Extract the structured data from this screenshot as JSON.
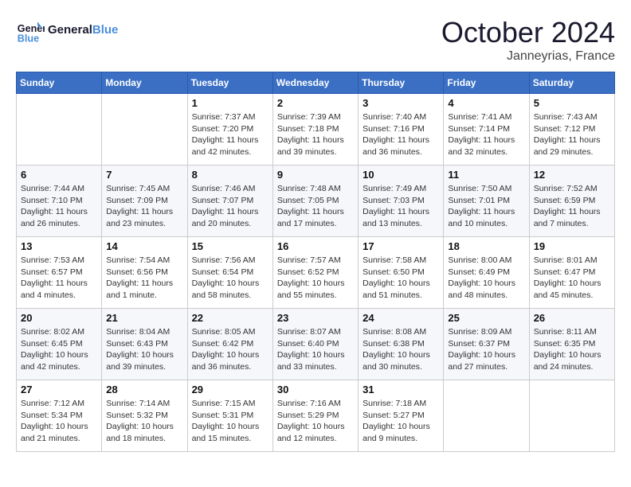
{
  "header": {
    "logo_general": "General",
    "logo_blue": "Blue",
    "month": "October 2024",
    "location": "Janneyrias, France"
  },
  "weekdays": [
    "Sunday",
    "Monday",
    "Tuesday",
    "Wednesday",
    "Thursday",
    "Friday",
    "Saturday"
  ],
  "weeks": [
    [
      {
        "day": "",
        "empty": true
      },
      {
        "day": "",
        "empty": true
      },
      {
        "day": "1",
        "sunrise": "Sunrise: 7:37 AM",
        "sunset": "Sunset: 7:20 PM",
        "daylight": "Daylight: 11 hours and 42 minutes."
      },
      {
        "day": "2",
        "sunrise": "Sunrise: 7:39 AM",
        "sunset": "Sunset: 7:18 PM",
        "daylight": "Daylight: 11 hours and 39 minutes."
      },
      {
        "day": "3",
        "sunrise": "Sunrise: 7:40 AM",
        "sunset": "Sunset: 7:16 PM",
        "daylight": "Daylight: 11 hours and 36 minutes."
      },
      {
        "day": "4",
        "sunrise": "Sunrise: 7:41 AM",
        "sunset": "Sunset: 7:14 PM",
        "daylight": "Daylight: 11 hours and 32 minutes."
      },
      {
        "day": "5",
        "sunrise": "Sunrise: 7:43 AM",
        "sunset": "Sunset: 7:12 PM",
        "daylight": "Daylight: 11 hours and 29 minutes."
      }
    ],
    [
      {
        "day": "6",
        "sunrise": "Sunrise: 7:44 AM",
        "sunset": "Sunset: 7:10 PM",
        "daylight": "Daylight: 11 hours and 26 minutes."
      },
      {
        "day": "7",
        "sunrise": "Sunrise: 7:45 AM",
        "sunset": "Sunset: 7:09 PM",
        "daylight": "Daylight: 11 hours and 23 minutes."
      },
      {
        "day": "8",
        "sunrise": "Sunrise: 7:46 AM",
        "sunset": "Sunset: 7:07 PM",
        "daylight": "Daylight: 11 hours and 20 minutes."
      },
      {
        "day": "9",
        "sunrise": "Sunrise: 7:48 AM",
        "sunset": "Sunset: 7:05 PM",
        "daylight": "Daylight: 11 hours and 17 minutes."
      },
      {
        "day": "10",
        "sunrise": "Sunrise: 7:49 AM",
        "sunset": "Sunset: 7:03 PM",
        "daylight": "Daylight: 11 hours and 13 minutes."
      },
      {
        "day": "11",
        "sunrise": "Sunrise: 7:50 AM",
        "sunset": "Sunset: 7:01 PM",
        "daylight": "Daylight: 11 hours and 10 minutes."
      },
      {
        "day": "12",
        "sunrise": "Sunrise: 7:52 AM",
        "sunset": "Sunset: 6:59 PM",
        "daylight": "Daylight: 11 hours and 7 minutes."
      }
    ],
    [
      {
        "day": "13",
        "sunrise": "Sunrise: 7:53 AM",
        "sunset": "Sunset: 6:57 PM",
        "daylight": "Daylight: 11 hours and 4 minutes."
      },
      {
        "day": "14",
        "sunrise": "Sunrise: 7:54 AM",
        "sunset": "Sunset: 6:56 PM",
        "daylight": "Daylight: 11 hours and 1 minute."
      },
      {
        "day": "15",
        "sunrise": "Sunrise: 7:56 AM",
        "sunset": "Sunset: 6:54 PM",
        "daylight": "Daylight: 10 hours and 58 minutes."
      },
      {
        "day": "16",
        "sunrise": "Sunrise: 7:57 AM",
        "sunset": "Sunset: 6:52 PM",
        "daylight": "Daylight: 10 hours and 55 minutes."
      },
      {
        "day": "17",
        "sunrise": "Sunrise: 7:58 AM",
        "sunset": "Sunset: 6:50 PM",
        "daylight": "Daylight: 10 hours and 51 minutes."
      },
      {
        "day": "18",
        "sunrise": "Sunrise: 8:00 AM",
        "sunset": "Sunset: 6:49 PM",
        "daylight": "Daylight: 10 hours and 48 minutes."
      },
      {
        "day": "19",
        "sunrise": "Sunrise: 8:01 AM",
        "sunset": "Sunset: 6:47 PM",
        "daylight": "Daylight: 10 hours and 45 minutes."
      }
    ],
    [
      {
        "day": "20",
        "sunrise": "Sunrise: 8:02 AM",
        "sunset": "Sunset: 6:45 PM",
        "daylight": "Daylight: 10 hours and 42 minutes."
      },
      {
        "day": "21",
        "sunrise": "Sunrise: 8:04 AM",
        "sunset": "Sunset: 6:43 PM",
        "daylight": "Daylight: 10 hours and 39 minutes."
      },
      {
        "day": "22",
        "sunrise": "Sunrise: 8:05 AM",
        "sunset": "Sunset: 6:42 PM",
        "daylight": "Daylight: 10 hours and 36 minutes."
      },
      {
        "day": "23",
        "sunrise": "Sunrise: 8:07 AM",
        "sunset": "Sunset: 6:40 PM",
        "daylight": "Daylight: 10 hours and 33 minutes."
      },
      {
        "day": "24",
        "sunrise": "Sunrise: 8:08 AM",
        "sunset": "Sunset: 6:38 PM",
        "daylight": "Daylight: 10 hours and 30 minutes."
      },
      {
        "day": "25",
        "sunrise": "Sunrise: 8:09 AM",
        "sunset": "Sunset: 6:37 PM",
        "daylight": "Daylight: 10 hours and 27 minutes."
      },
      {
        "day": "26",
        "sunrise": "Sunrise: 8:11 AM",
        "sunset": "Sunset: 6:35 PM",
        "daylight": "Daylight: 10 hours and 24 minutes."
      }
    ],
    [
      {
        "day": "27",
        "sunrise": "Sunrise: 7:12 AM",
        "sunset": "Sunset: 5:34 PM",
        "daylight": "Daylight: 10 hours and 21 minutes."
      },
      {
        "day": "28",
        "sunrise": "Sunrise: 7:14 AM",
        "sunset": "Sunset: 5:32 PM",
        "daylight": "Daylight: 10 hours and 18 minutes."
      },
      {
        "day": "29",
        "sunrise": "Sunrise: 7:15 AM",
        "sunset": "Sunset: 5:31 PM",
        "daylight": "Daylight: 10 hours and 15 minutes."
      },
      {
        "day": "30",
        "sunrise": "Sunrise: 7:16 AM",
        "sunset": "Sunset: 5:29 PM",
        "daylight": "Daylight: 10 hours and 12 minutes."
      },
      {
        "day": "31",
        "sunrise": "Sunrise: 7:18 AM",
        "sunset": "Sunset: 5:27 PM",
        "daylight": "Daylight: 10 hours and 9 minutes."
      },
      {
        "day": "",
        "empty": true
      },
      {
        "day": "",
        "empty": true
      }
    ]
  ]
}
